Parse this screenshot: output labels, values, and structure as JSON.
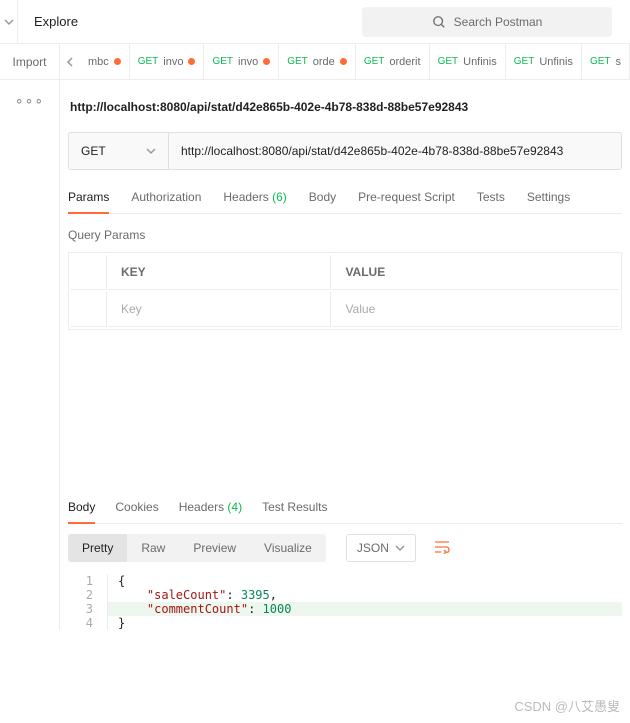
{
  "header": {
    "explore": "Explore",
    "search_placeholder": "Search Postman",
    "import": "Import"
  },
  "tabs": [
    {
      "method": "",
      "name": "mbc",
      "dirty": true
    },
    {
      "method": "GET",
      "name": "invo",
      "dirty": true
    },
    {
      "method": "GET",
      "name": "invo",
      "dirty": true
    },
    {
      "method": "GET",
      "name": "orde",
      "dirty": true
    },
    {
      "method": "GET",
      "name": "orderit",
      "dirty": false
    },
    {
      "method": "GET",
      "name": "Unfinis",
      "dirty": false
    },
    {
      "method": "GET",
      "name": "Unfinis",
      "dirty": false
    },
    {
      "method": "GET",
      "name": "s",
      "dirty": false
    }
  ],
  "breadcrumb": "http://localhost:8080/api/stat/d42e865b-402e-4b78-838d-88be57e92843",
  "request": {
    "method": "GET",
    "url": "http://localhost:8080/api/stat/d42e865b-402e-4b78-838d-88be57e92843"
  },
  "req_tabs": {
    "params": "Params",
    "auth": "Authorization",
    "headers": "Headers",
    "headers_count": "(6)",
    "body": "Body",
    "prereq": "Pre-request Script",
    "tests": "Tests",
    "settings": "Settings"
  },
  "query_params": {
    "label": "Query Params",
    "key_header": "KEY",
    "value_header": "VALUE",
    "key_placeholder": "Key",
    "value_placeholder": "Value"
  },
  "resp_tabs": {
    "body": "Body",
    "cookies": "Cookies",
    "headers": "Headers",
    "headers_count": "(4)",
    "tests": "Test Results"
  },
  "body_views": {
    "pretty": "Pretty",
    "raw": "Raw",
    "preview": "Preview",
    "visualize": "Visualize",
    "format": "JSON"
  },
  "response_body": {
    "saleCount_key": "\"saleCount\"",
    "saleCount_val": "3395",
    "commentCount_key": "\"commentCount\"",
    "commentCount_val": "1000"
  },
  "watermark": "CSDN @八艾愚叟"
}
